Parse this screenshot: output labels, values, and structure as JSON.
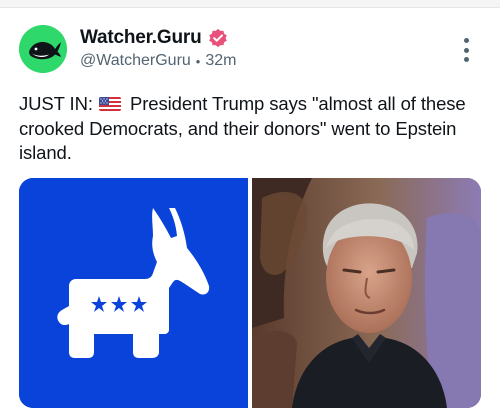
{
  "account": {
    "name": "Watcher.Guru",
    "handle": "@WatcherGuru",
    "separator": "•",
    "time": "32m",
    "verified": true,
    "avatar_icon": "whale-logo-icon",
    "avatar_color": "#2fd86b",
    "verified_color": "#e8527a"
  },
  "tweet": {
    "prefix": "JUST IN:",
    "flag_icon": "us-flag-icon",
    "text": "President Trump says \"almost all of these crooked Democrats, and their donors\" went to Epstein island."
  },
  "media": {
    "left_icon": "democratic-donkey-logo-icon",
    "left_bg": "#0a43d9",
    "right_icon": "man-portrait-photo"
  }
}
